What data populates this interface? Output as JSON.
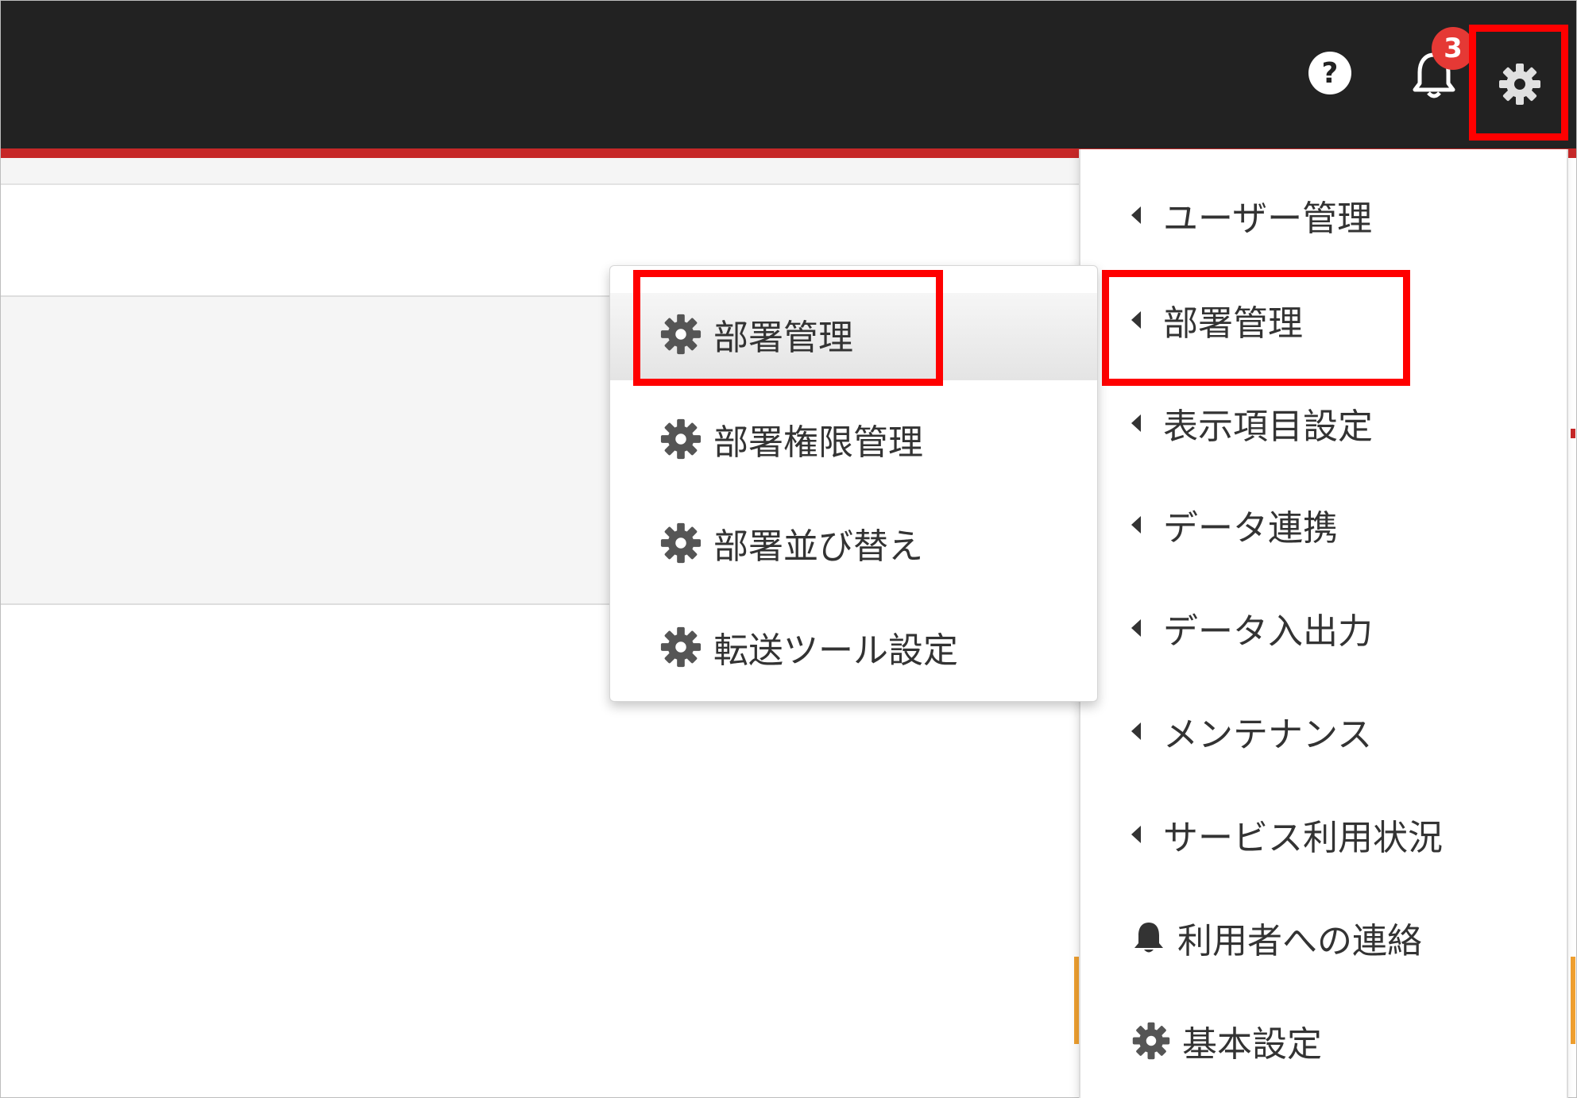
{
  "header": {
    "help_icon": "question-circle-icon",
    "notifications": {
      "icon": "bell-icon",
      "count": "3"
    },
    "settings_icon": "gear-icon"
  },
  "settings_menu": {
    "items": [
      {
        "label": "ユーザー管理",
        "icon": "caret-left-icon"
      },
      {
        "label": "部署管理",
        "icon": "caret-left-icon"
      },
      {
        "label": "表示項目設定",
        "icon": "caret-left-icon"
      },
      {
        "label": "データ連携",
        "icon": "caret-left-icon"
      },
      {
        "label": "データ入出力",
        "icon": "caret-left-icon"
      },
      {
        "label": "メンテナンス",
        "icon": "caret-left-icon"
      },
      {
        "label": "サービス利用状況",
        "icon": "caret-left-icon"
      },
      {
        "label": "利用者への連絡",
        "icon": "bell-icon"
      },
      {
        "label": "基本設定",
        "icon": "gear-icon"
      }
    ]
  },
  "department_submenu": {
    "items": [
      {
        "label": "部署管理",
        "icon": "gear-icon"
      },
      {
        "label": "部署権限管理",
        "icon": "gear-icon"
      },
      {
        "label": "部署並び替え",
        "icon": "gear-icon"
      },
      {
        "label": "転送ツール設定",
        "icon": "gear-icon"
      }
    ]
  },
  "colors": {
    "header_bg": "#222222",
    "accent_red": "#c62828",
    "highlight_box": "#ff0000",
    "badge": "#e53935"
  }
}
